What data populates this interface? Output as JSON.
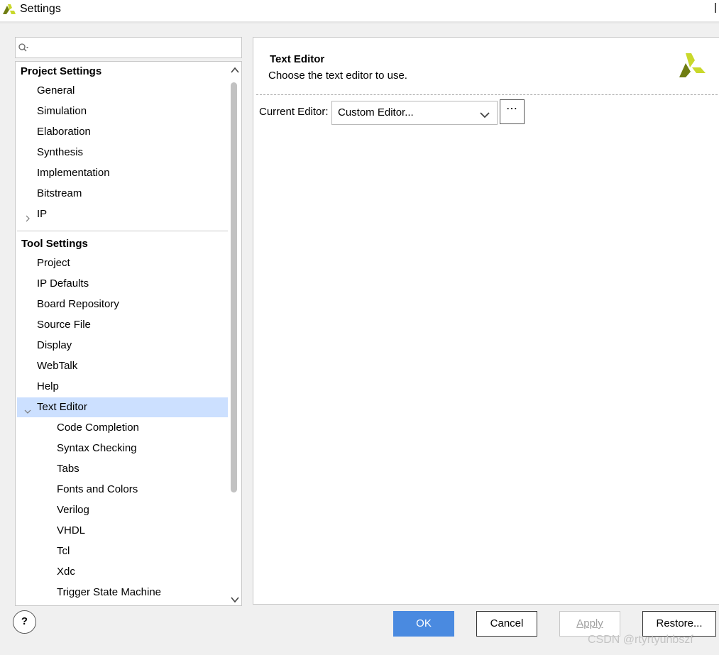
{
  "window": {
    "title": "Settings",
    "logo_icon": "xilinx-logo"
  },
  "search": {
    "value": "",
    "icon": "search-icon"
  },
  "tree": {
    "project_settings": {
      "header": "Project Settings",
      "items": [
        "General",
        "Simulation",
        "Elaboration",
        "Synthesis",
        "Implementation",
        "Bitstream",
        "IP"
      ]
    },
    "tool_settings": {
      "header": "Tool Settings",
      "items": [
        "Project",
        "IP Defaults",
        "Board Repository",
        "Source File",
        "Display",
        "WebTalk",
        "Help",
        "Text Editor"
      ],
      "text_editor_children": [
        "Code Completion",
        "Syntax Checking",
        "Tabs",
        "Fonts and Colors",
        "Verilog",
        "VHDL",
        "Tcl",
        "Xdc",
        "Trigger State Machine"
      ]
    },
    "selected": "Text Editor"
  },
  "panel": {
    "title": "Text Editor",
    "description": "Choose the text editor to use.",
    "current_editor_label": "Current Editor:",
    "current_editor_value": "Custom Editor...",
    "browse_label": "⋯"
  },
  "buttons": {
    "help": "?",
    "ok": "OK",
    "cancel": "Cancel",
    "apply": "Apply",
    "restore": "Restore..."
  },
  "watermark": "CSDN @rtyrtyuhbszf",
  "colors": {
    "selection": "#cce0ff",
    "ok_button": "#4a8ae0",
    "logo_dark": "#6f7d12",
    "logo_light": "#c9d82b"
  }
}
